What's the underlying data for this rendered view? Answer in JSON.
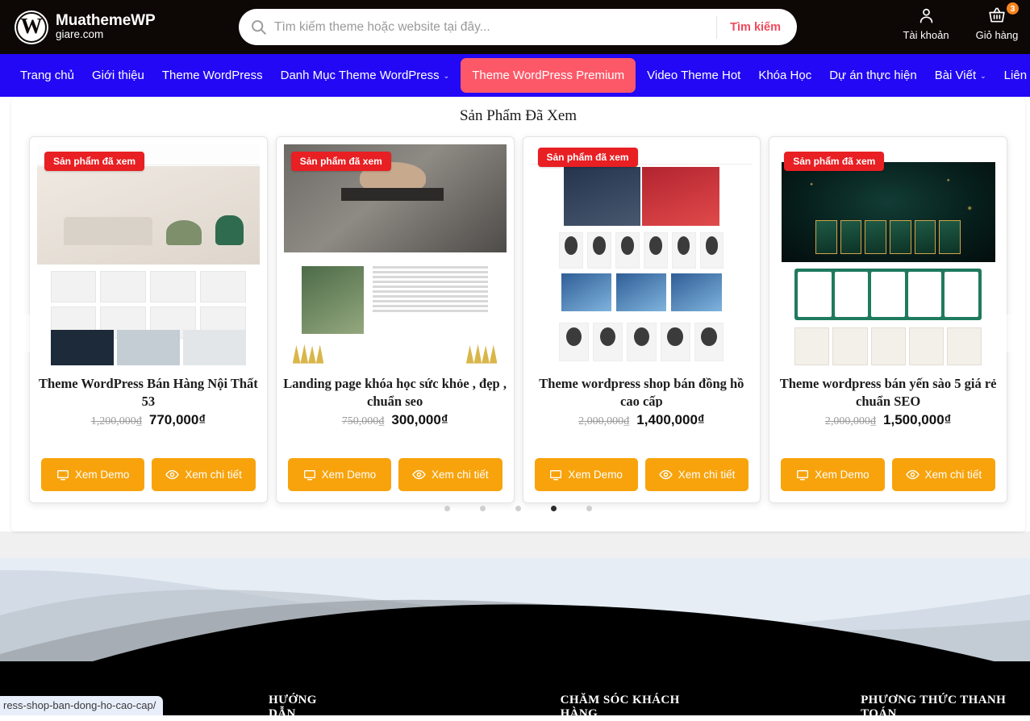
{
  "header": {
    "brand_name": "MuathemeWP",
    "brand_sub": "giare.com",
    "brand_mark": "W",
    "search_placeholder": "Tìm kiếm theme hoặc website tại đây...",
    "search_value": "",
    "search_button": "Tìm kiếm",
    "account_label": "Tài khoản",
    "cart_label": "Giỏ hàng",
    "cart_count": "3",
    "icons": {
      "search": "search-icon",
      "account": "user-icon",
      "cart": "shopping-basket-icon"
    }
  },
  "nav": {
    "items": [
      {
        "label": "Trang chủ",
        "has_caret": false,
        "active": false
      },
      {
        "label": "Giới thiệu",
        "has_caret": false,
        "active": false
      },
      {
        "label": "Theme WordPress",
        "has_caret": false,
        "active": false
      },
      {
        "label": "Danh Mục Theme WordPress",
        "has_caret": true,
        "active": false
      },
      {
        "label": "Theme WordPress Premium",
        "has_caret": false,
        "active": true
      },
      {
        "label": "Video Theme Hot",
        "has_caret": false,
        "active": false
      },
      {
        "label": "Khóa Học",
        "has_caret": false,
        "active": false
      },
      {
        "label": "Dự án thực hiện",
        "has_caret": false,
        "active": false
      },
      {
        "label": "Bài Viết",
        "has_caret": true,
        "active": false
      },
      {
        "label": "Liên hệ",
        "has_caret": false,
        "active": false
      }
    ],
    "caret_glyph": "⌄"
  },
  "viewed_section": {
    "title": "Sản Phẩm Đã Xem",
    "ribbon_label": "Sản phẩm đã xem",
    "demo_label": "Xem Demo",
    "detail_label": "Xem chi tiết",
    "products": [
      {
        "title": "Theme WordPress Bán Hàng Nội Thất 53",
        "old_price": "1,200,000₫",
        "new_price": "770,000₫"
      },
      {
        "title": "Landing page khóa học sức khỏe , đẹp , chuẩn seo",
        "old_price": "750,000₫",
        "new_price": "300,000₫"
      },
      {
        "title": "Theme wordpress shop bán đồng hồ cao cấp",
        "old_price": "2,000,000₫",
        "new_price": "1,400,000₫"
      },
      {
        "title": "Theme wordpress bán yến sào 5 giá rẻ chuẩn SEO",
        "old_price": "2,000,000₫",
        "new_price": "1,500,000₫"
      }
    ],
    "dots": [
      false,
      false,
      false,
      true,
      false
    ],
    "prev_glyph": "‹",
    "next_glyph": "›"
  },
  "footer": {
    "columns": [
      "HƯỚNG DẪN",
      "CHĂM SÓC KHÁCH HÀNG",
      "PHƯƠNG THỨC THANH TOÁN"
    ]
  },
  "status_bar": {
    "url": "ress-shop-ban-dong-ho-cao-cap/"
  },
  "colors": {
    "header_bg": "#0d0705",
    "nav_bg": "#2208f4",
    "nav_active": "#fd5868",
    "ribbon": "#e81f23",
    "button": "#f8a30c",
    "search_btn": "#ef4a5c",
    "cart_badge": "#f6851f"
  }
}
